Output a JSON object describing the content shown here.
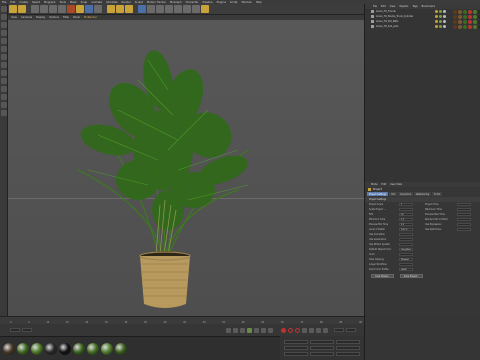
{
  "menubar": {
    "items": [
      "File",
      "Edit",
      "Create",
      "Select",
      "Mograph",
      "Tools",
      "Mesh",
      "Snap",
      "Animate",
      "Simulate",
      "Render",
      "Sculpt",
      "Motion Tracker",
      "MoGraph",
      "Character",
      "Pipeline",
      "Plugins",
      "Script",
      "Window",
      "Help"
    ]
  },
  "toolbar": {
    "buttons": [
      "undo",
      "redo",
      "select",
      "move",
      "scale",
      "rotate",
      "x-axis",
      "y-axis",
      "z-axis",
      "coord-system",
      "render-view",
      "render-pic",
      "edit-render-settings",
      "cube",
      "pen",
      "subdiv",
      "array",
      "deformer",
      "floor",
      "camera",
      "light"
    ]
  },
  "viewport_header": {
    "items": [
      "View",
      "Cameras",
      "Display",
      "Options",
      "Filter",
      "Panel",
      "ProRender"
    ],
    "active_index": 6
  },
  "object_manager": {
    "menu": [
      "File",
      "Edit",
      "View",
      "Objects",
      "Tags",
      "Bookmarks"
    ],
    "objects": [
      {
        "name": "Areca_TO_Fronds"
      },
      {
        "name": "Areca_TO_Stems_Trunk_Cylinder"
      },
      {
        "name": "Areca_TO_Pot_Mats"
      },
      {
        "name": "Areca_TO_Soil_pots"
      }
    ]
  },
  "attribute_manager": {
    "menu": [
      "Mode",
      "Edit",
      "User Data"
    ],
    "title": "Project",
    "tabs": [
      "Project Settings",
      "Info",
      "Dynamics",
      "Referencing",
      "To Do"
    ],
    "active_tab": 0,
    "section": "Project Settings",
    "fields_left": [
      {
        "label": "Project Scale",
        "value": "1"
      },
      {
        "label": "Scale Project ...",
        "value": ""
      },
      {
        "label": "FPS",
        "value": "30"
      },
      {
        "label": "Minimum Time",
        "value": "0 F"
      },
      {
        "label": "Preview Min Time",
        "value": "0 F"
      },
      {
        "label": "Level of Detail",
        "value": "100 %"
      },
      {
        "label": "Use Animation",
        "value": ""
      },
      {
        "label": "Use Generators",
        "value": ""
      },
      {
        "label": "Use Motion System",
        "value": ""
      },
      {
        "label": "Default Object Color",
        "value": "Gray-Blue"
      },
      {
        "label": "Color",
        "value": ""
      },
      {
        "label": "View Clipping",
        "value": "Medium"
      },
      {
        "label": "Linear Workflow",
        "value": ""
      },
      {
        "label": "Input Color Profile",
        "value": "sRGB"
      }
    ],
    "fields_right": [
      {
        "label": "Project Time"
      },
      {
        "label": "Maximum Time"
      },
      {
        "label": "Preview Max Time"
      },
      {
        "label": "Render LOD in Editor"
      },
      {
        "label": "Use Expression"
      },
      {
        "label": "Use Deformers"
      }
    ],
    "buttons": [
      "Load Preset...",
      "Save Preset..."
    ]
  },
  "materials": {
    "swatches": [
      {
        "name": "soil",
        "color": "#4a3a26"
      },
      {
        "name": "frond-green-1",
        "color": "#3e6b22"
      },
      {
        "name": "frond-green-2",
        "color": "#4f7a2a"
      },
      {
        "name": "dark",
        "color": "#2a2a2a"
      },
      {
        "name": "black",
        "color": "#111111"
      },
      {
        "name": "frond-green-3",
        "color": "#3a6420"
      },
      {
        "name": "frond-green-4",
        "color": "#456f25"
      },
      {
        "name": "frond-green-5",
        "color": "#517d2e"
      },
      {
        "name": "frond-green-6",
        "color": "#3c5f1f"
      }
    ]
  },
  "colors": {
    "accent": "#5b7cae",
    "toolbar_icon": "#c9a23a",
    "record": "#bb3333"
  },
  "timeline": {
    "ticks": [
      "0",
      "5",
      "10",
      "15",
      "20",
      "25",
      "30",
      "35",
      "40",
      "45",
      "50",
      "55",
      "60",
      "65",
      "70",
      "75",
      "80",
      "85",
      "90"
    ]
  }
}
